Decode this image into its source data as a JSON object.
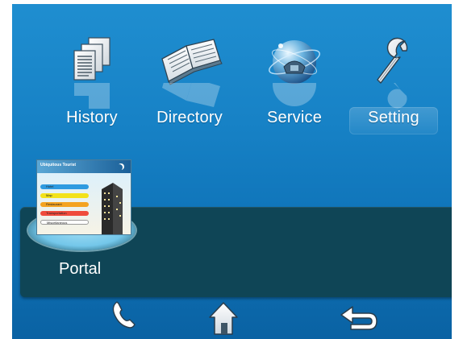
{
  "screen": {
    "colors": {
      "background_top": "#1f8ed0",
      "background_bottom": "#0a62a3",
      "tray": "#0f4556"
    }
  },
  "apps": [
    {
      "id": "history",
      "label": "History",
      "icon": "document-stack-icon"
    },
    {
      "id": "directory",
      "label": "Directory",
      "icon": "open-book-icon"
    },
    {
      "id": "service",
      "label": "Service",
      "icon": "globe-phone-icon"
    },
    {
      "id": "setting",
      "label": "Setting",
      "icon": "wrench-icon"
    }
  ],
  "portal": {
    "label": "Portal",
    "thumbnail": {
      "title": "Ubiquitous Tourist",
      "menu": [
        "Hotel",
        "Map",
        "Restaurant",
        "Transportation",
        "Miscellaneous"
      ]
    }
  },
  "dock": [
    {
      "id": "phone",
      "icon": "phone-handset-icon"
    },
    {
      "id": "home",
      "icon": "home-icon"
    },
    {
      "id": "back",
      "icon": "back-arrow-icon"
    }
  ]
}
